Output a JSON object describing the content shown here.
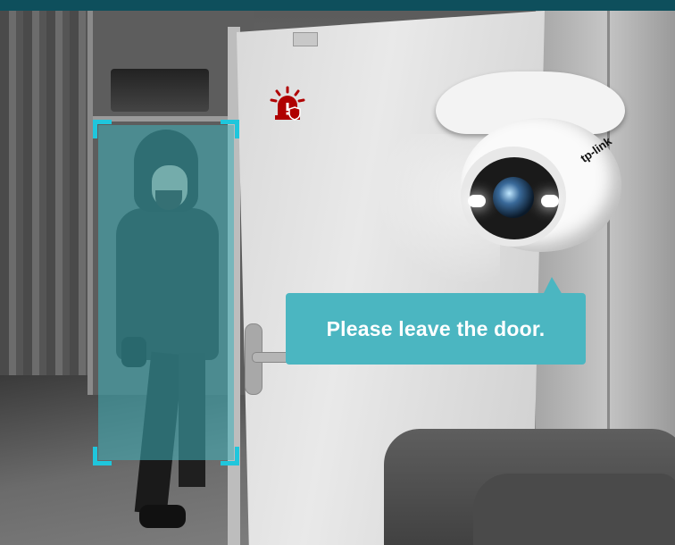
{
  "speech_bubble": {
    "text": "Please leave the door."
  },
  "camera": {
    "logo": "tp-link"
  },
  "detection": {
    "target": "person"
  },
  "colors": {
    "header_bar": "#0e4f5c",
    "detection_fill": "#3eb0b9",
    "detection_corner": "#1fc6dc",
    "bubble": "#4bb6c1",
    "alarm_icon": "#b00000"
  },
  "icons": [
    "alarm-siren-icon",
    "shield-icon"
  ]
}
